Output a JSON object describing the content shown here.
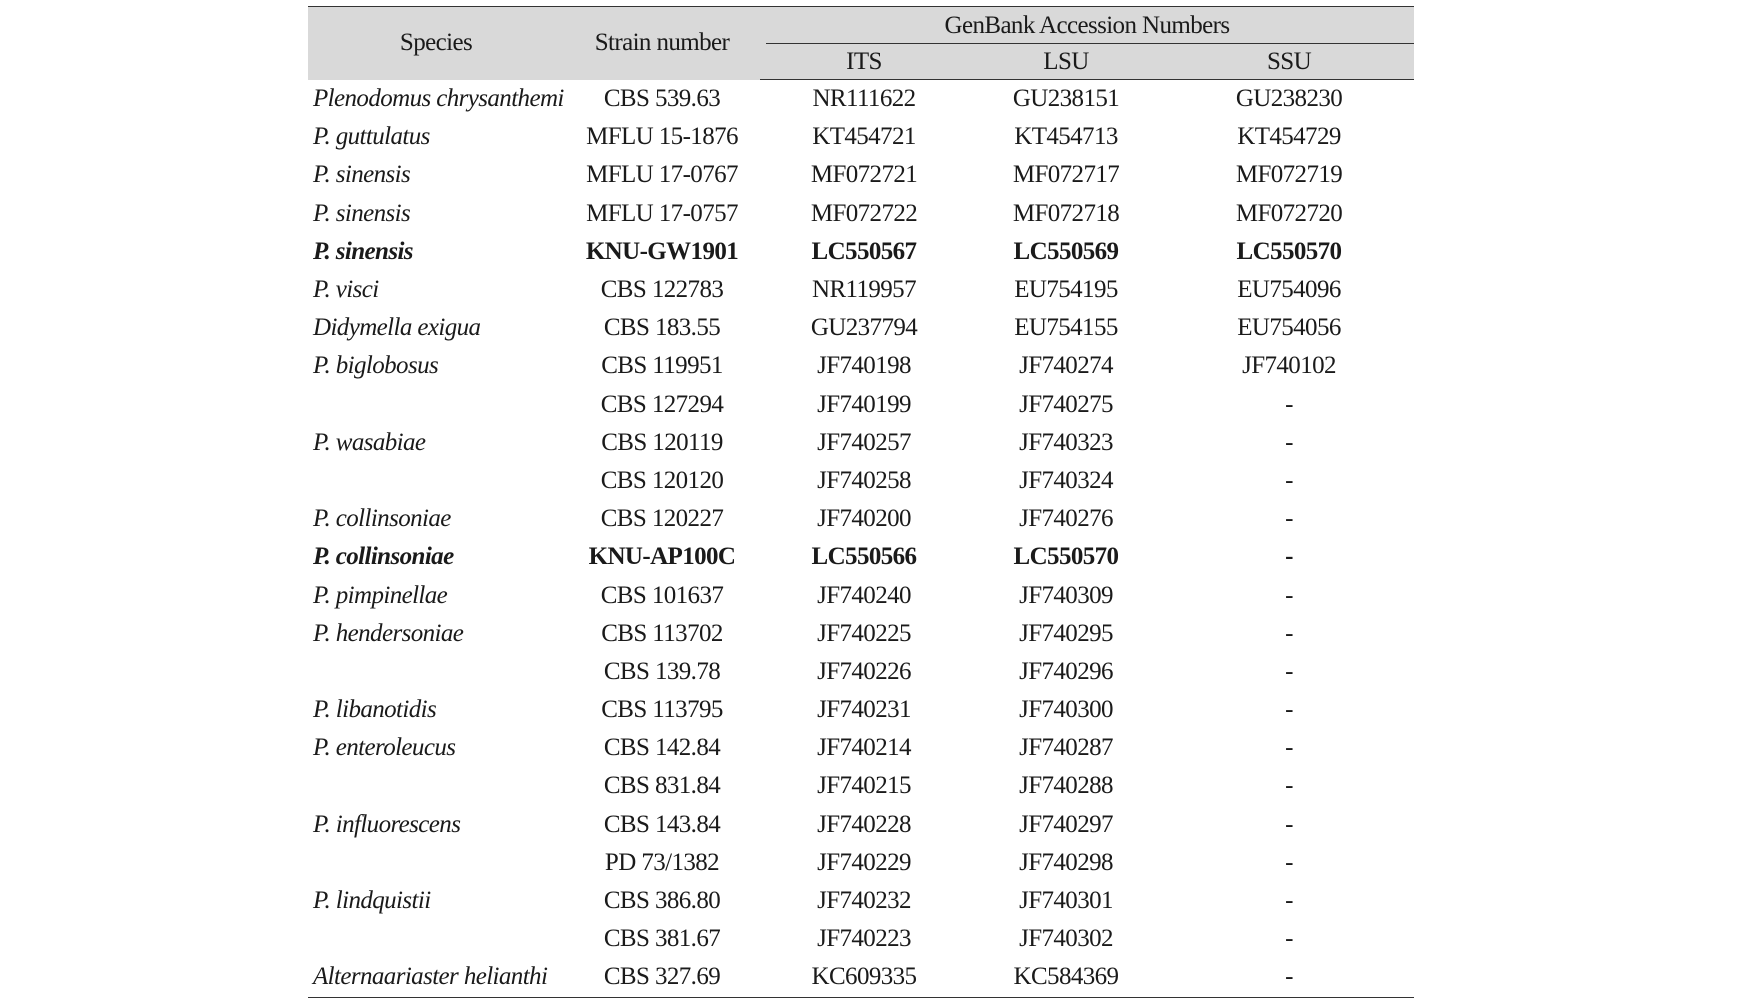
{
  "table": {
    "headers": {
      "species": "Species",
      "strain": "Strain number",
      "genbank": "GenBank Accession Numbers",
      "its": "ITS",
      "lsu": "LSU",
      "ssu": "SSU"
    },
    "rows": [
      {
        "species": "Plenodomus chrysanthemi",
        "strain": "CBS 539.63",
        "its": "NR111622",
        "lsu": "GU238151",
        "ssu": "GU238230",
        "bold": false
      },
      {
        "species": "P. guttulatus",
        "strain": "MFLU 15-1876",
        "its": "KT454721",
        "lsu": "KT454713",
        "ssu": "KT454729",
        "bold": false
      },
      {
        "species": "P. sinensis",
        "strain": "MFLU 17-0767",
        "its": "MF072721",
        "lsu": "MF072717",
        "ssu": "MF072719",
        "bold": false
      },
      {
        "species": "P. sinensis",
        "strain": "MFLU 17-0757",
        "its": "MF072722",
        "lsu": "MF072718",
        "ssu": "MF072720",
        "bold": false
      },
      {
        "species": "P. sinensis",
        "strain": "KNU-GW1901",
        "its": "LC550567",
        "lsu": "LC550569",
        "ssu": "LC550570",
        "bold": true
      },
      {
        "species": "P. visci",
        "strain": "CBS 122783",
        "its": "NR119957",
        "lsu": "EU754195",
        "ssu": "EU754096",
        "bold": false
      },
      {
        "species": "Didymella exigua",
        "strain": "CBS 183.55",
        "its": "GU237794",
        "lsu": "EU754155",
        "ssu": "EU754056",
        "bold": false
      },
      {
        "species": "P. biglobosus",
        "strain": "CBS 119951",
        "its": "JF740198",
        "lsu": "JF740274",
        "ssu": "JF740102",
        "bold": false
      },
      {
        "species": "",
        "strain": "CBS 127294",
        "its": "JF740199",
        "lsu": "JF740275",
        "ssu": "-",
        "bold": false
      },
      {
        "species": "P. wasabiae",
        "strain": "CBS 120119",
        "its": "JF740257",
        "lsu": "JF740323",
        "ssu": "-",
        "bold": false
      },
      {
        "species": "",
        "strain": "CBS 120120",
        "its": "JF740258",
        "lsu": "JF740324",
        "ssu": "-",
        "bold": false
      },
      {
        "species": "P. collinsoniae",
        "strain": "CBS 120227",
        "its": "JF740200",
        "lsu": "JF740276",
        "ssu": "-",
        "bold": false
      },
      {
        "species": "P. collinsoniae",
        "strain": "KNU-AP100C",
        "its": "LC550566",
        "lsu": "LC550570",
        "ssu": "-",
        "bold": true
      },
      {
        "species": "P. pimpinellae",
        "strain": "CBS 101637",
        "its": "JF740240",
        "lsu": "JF740309",
        "ssu": "-",
        "bold": false
      },
      {
        "species": "P. hendersoniae",
        "strain": "CBS 113702",
        "its": "JF740225",
        "lsu": "JF740295",
        "ssu": "-",
        "bold": false
      },
      {
        "species": "",
        "strain": "CBS 139.78",
        "its": "JF740226",
        "lsu": "JF740296",
        "ssu": "-",
        "bold": false
      },
      {
        "species": "P. libanotidis",
        "strain": "CBS 113795",
        "its": "JF740231",
        "lsu": "JF740300",
        "ssu": "-",
        "bold": false
      },
      {
        "species": "P. enteroleucus",
        "strain": "CBS 142.84",
        "its": "JF740214",
        "lsu": "JF740287",
        "ssu": "-",
        "bold": false
      },
      {
        "species": "",
        "strain": "CBS 831.84",
        "its": "JF740215",
        "lsu": "JF740288",
        "ssu": "-",
        "bold": false
      },
      {
        "species": "P. influorescens",
        "strain": "CBS 143.84",
        "its": "JF740228",
        "lsu": "JF740297",
        "ssu": "-",
        "bold": false
      },
      {
        "species": "",
        "strain": "PD 73/1382",
        "its": "JF740229",
        "lsu": "JF740298",
        "ssu": "-",
        "bold": false
      },
      {
        "species": "P. lindquistii",
        "strain": "CBS 386.80",
        "its": "JF740232",
        "lsu": "JF740301",
        "ssu": "-",
        "bold": false
      },
      {
        "species": "",
        "strain": "CBS 381.67",
        "its": "JF740223",
        "lsu": "JF740302",
        "ssu": "-",
        "bold": false
      },
      {
        "species": "Alternaariaster helianthi",
        "strain": "CBS 327.69",
        "its": "KC609335",
        "lsu": "KC584369",
        "ssu": "-",
        "bold": false
      }
    ]
  }
}
